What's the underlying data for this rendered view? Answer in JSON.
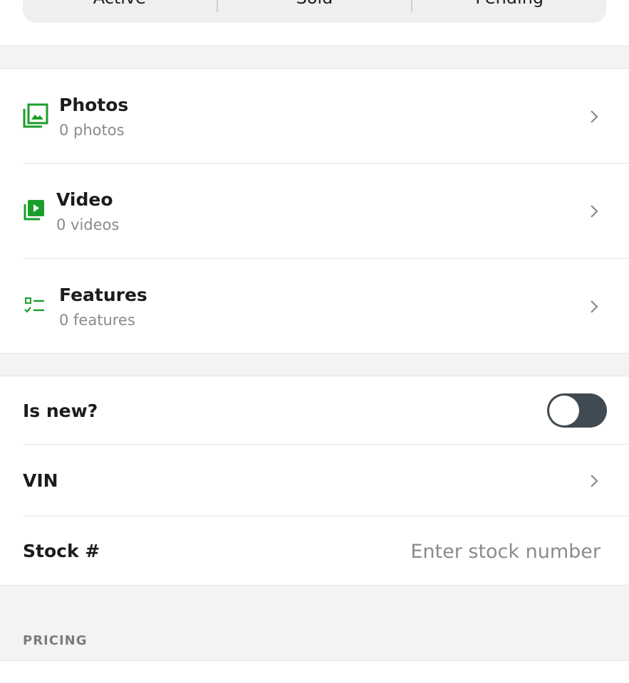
{
  "status_segments": [
    "Active",
    "Sold",
    "Pending"
  ],
  "media": {
    "photos": {
      "title": "Photos",
      "subtitle": "0 photos",
      "icon": "photo-library-icon"
    },
    "video": {
      "title": "Video",
      "subtitle": "0 videos",
      "icon": "video-library-icon"
    },
    "features": {
      "title": "Features",
      "subtitle": "0 features",
      "icon": "checklist-icon"
    }
  },
  "fields": {
    "is_new": {
      "label": "Is new?",
      "value": false
    },
    "vin": {
      "label": "VIN"
    },
    "stock": {
      "label": "Stock #",
      "value": "",
      "placeholder": "Enter stock number"
    }
  },
  "sections": {
    "pricing": "PRICING"
  },
  "colors": {
    "accent_green": "#1a9e2a",
    "toggle_off": "#3f4a52",
    "section_background": "#f3f3f3"
  }
}
